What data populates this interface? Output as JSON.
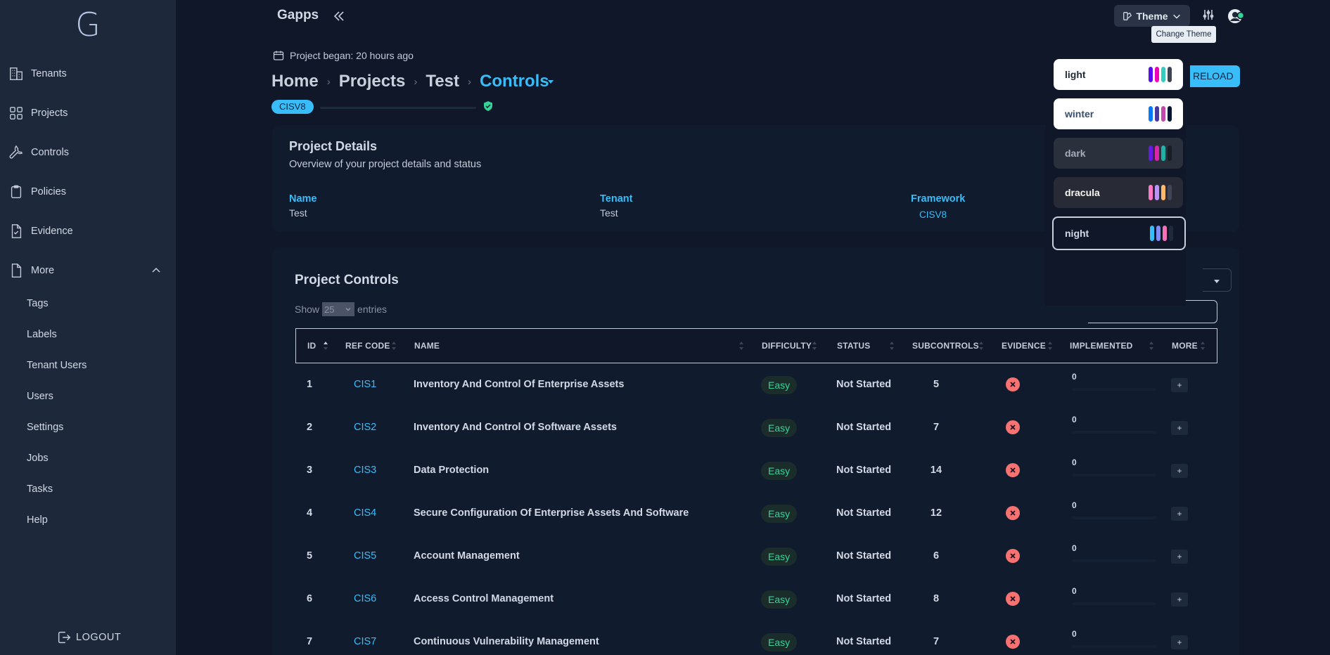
{
  "sidebar": {
    "logo": "G",
    "items": [
      {
        "label": "Tenants",
        "icon": "building-icon"
      },
      {
        "label": "Projects",
        "icon": "grid-icon"
      },
      {
        "label": "Controls",
        "icon": "wrench-icon"
      },
      {
        "label": "Policies",
        "icon": "clipboard-icon"
      },
      {
        "label": "Evidence",
        "icon": "file-check-icon"
      },
      {
        "label": "More",
        "icon": "file-icon"
      }
    ],
    "sub_items": [
      "Tags",
      "Labels",
      "Tenant Users",
      "Users",
      "Settings",
      "Jobs",
      "Tasks",
      "Help"
    ],
    "logout": "LOGOUT"
  },
  "topbar": {
    "app_title": "Gapps",
    "theme_label": "Theme",
    "tooltip": "Change Theme"
  },
  "page": {
    "project_began": "Project began: 20 hours ago",
    "breadcrumb": [
      "Home",
      "Projects",
      "Test",
      "Controls"
    ],
    "framework_badge": "CISV8",
    "reload": "RELOAD"
  },
  "details": {
    "title": "Project Details",
    "subtitle": "Overview of your project details and status",
    "name_label": "Name",
    "name_value": "Test",
    "tenant_label": "Tenant",
    "tenant_value": "Test",
    "framework_label": "Framework",
    "framework_value": "CISV8"
  },
  "controls": {
    "title": "Project Controls",
    "show_label": "Show",
    "show_value": "25",
    "entries_label": "entries",
    "columns": [
      "ID",
      "REF CODE",
      "NAME",
      "DIFFICULTY",
      "STATUS",
      "SUBCONTROLS",
      "EVIDENCE",
      "IMPLEMENTED",
      "MORE"
    ],
    "rows": [
      {
        "id": "1",
        "ref": "CIS1",
        "name": "Inventory And Control Of Enterprise Assets",
        "difficulty": "Easy",
        "status": "Not Started",
        "subcontrols": "5",
        "implemented": "0",
        "more": "+"
      },
      {
        "id": "2",
        "ref": "CIS2",
        "name": "Inventory And Control Of Software Assets",
        "difficulty": "Easy",
        "status": "Not Started",
        "subcontrols": "7",
        "implemented": "0",
        "more": "+"
      },
      {
        "id": "3",
        "ref": "CIS3",
        "name": "Data Protection",
        "difficulty": "Easy",
        "status": "Not Started",
        "subcontrols": "14",
        "implemented": "0",
        "more": "+"
      },
      {
        "id": "4",
        "ref": "CIS4",
        "name": "Secure Configuration Of Enterprise Assets And Software",
        "difficulty": "Easy",
        "status": "Not Started",
        "subcontrols": "12",
        "implemented": "0",
        "more": "+"
      },
      {
        "id": "5",
        "ref": "CIS5",
        "name": "Account Management",
        "difficulty": "Easy",
        "status": "Not Started",
        "subcontrols": "6",
        "implemented": "0",
        "more": "+"
      },
      {
        "id": "6",
        "ref": "CIS6",
        "name": "Access Control Management",
        "difficulty": "Easy",
        "status": "Not Started",
        "subcontrols": "8",
        "implemented": "0",
        "more": "+"
      },
      {
        "id": "7",
        "ref": "CIS7",
        "name": "Continuous Vulnerability Management",
        "difficulty": "Easy",
        "status": "Not Started",
        "subcontrols": "7",
        "implemented": "0",
        "more": "+"
      }
    ]
  },
  "themes": [
    {
      "name": "light",
      "bg": "#ffffff",
      "fg": "#1f2937",
      "colors": [
        "#570df8",
        "#f000b8",
        "#37cdbe",
        "#3d4451"
      ]
    },
    {
      "name": "winter",
      "bg": "#ffffff",
      "fg": "#394e6a",
      "colors": [
        "#047aff",
        "#463aa2",
        "#c148ac",
        "#021431"
      ]
    },
    {
      "name": "dark",
      "bg": "#2a303c",
      "fg": "#a6adbb",
      "colors": [
        "#661ae6",
        "#d926aa",
        "#1fb2a5",
        "#191d24"
      ]
    },
    {
      "name": "dracula",
      "bg": "#282a36",
      "fg": "#f8f8f2",
      "colors": [
        "#ff79c6",
        "#bd93f9",
        "#ffb86c",
        "#414558"
      ]
    },
    {
      "name": "night",
      "bg": "#0f1729",
      "fg": "#d2d9e5",
      "colors": [
        "#38bdf8",
        "#818cf8",
        "#f471b5",
        "#1e293b"
      ]
    }
  ],
  "colors": {
    "accent": "#38bdf8",
    "success": "#36d399",
    "error": "#f87272"
  }
}
